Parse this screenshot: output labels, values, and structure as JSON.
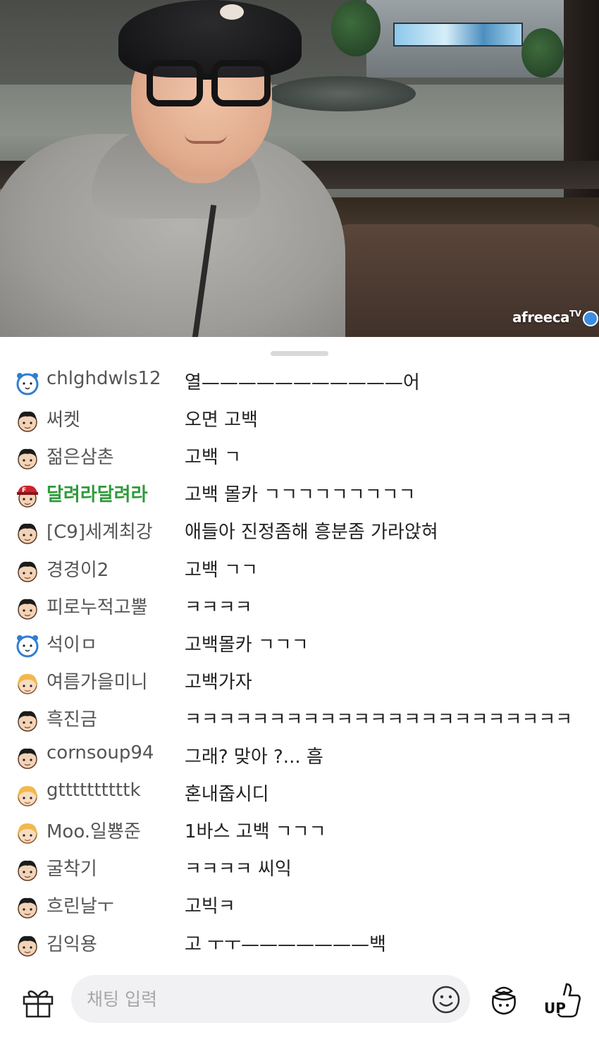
{
  "video": {
    "watermark": "afreeca",
    "watermark_suffix": "TV"
  },
  "chat": {
    "messages": [
      {
        "avatar": "mascot-icon",
        "nickname": "chlghdwls12",
        "text": "열———————————어"
      },
      {
        "avatar": "user-face-icon",
        "nickname": "써켓",
        "text": "오면 고백"
      },
      {
        "avatar": "user-face-icon",
        "nickname": "젊은삼촌",
        "text": "고백 ㄱ"
      },
      {
        "avatar": "fan-badge-icon",
        "nickname": "달려라달려라",
        "text": "고백 몰카 ㄱㄱㄱㄱㄱㄱㄱㄱㄱ",
        "highlight": true
      },
      {
        "avatar": "user-face-icon",
        "nickname": "[C9]세계최강",
        "text": "애들아 진정좀해 흥분좀 가라앉혀"
      },
      {
        "avatar": "user-face-icon",
        "nickname": "경경이2",
        "text": "고백 ㄱㄱ"
      },
      {
        "avatar": "user-face-icon",
        "nickname": "피로누적고뿔",
        "text": "ㅋㅋㅋㅋ"
      },
      {
        "avatar": "mascot-icon",
        "nickname": "석이ㅁ",
        "text": "고백몰카 ㄱㄱㄱ"
      },
      {
        "avatar": "girl-face-icon",
        "nickname": "여름가을미니",
        "text": "고백가자"
      },
      {
        "avatar": "user-face-icon",
        "nickname": "흑진금",
        "text": "ㅋㅋㅋㅋㅋㅋㅋㅋㅋㅋㅋㅋㅋㅋㅋㅋㅋㅋㅋㅋㅋㅋㅋ"
      },
      {
        "avatar": "user-face-icon",
        "nickname": "cornsoup94",
        "text": "그래? 맞아 ?... 흠"
      },
      {
        "avatar": "girl-face-icon",
        "nickname": "gttttttttttk",
        "text": "혼내줍시디"
      },
      {
        "avatar": "girl-face-icon",
        "nickname": "Moo.일뿅준",
        "text": "1바스 고백 ㄱㄱㄱ"
      },
      {
        "avatar": "user-face-icon",
        "nickname": "굴착기",
        "text": "ㅋㅋㅋㅋ 씨익"
      },
      {
        "avatar": "user-face-icon",
        "nickname": "흐린날ㅜ",
        "text": "고빅ㅋ"
      },
      {
        "avatar": "user-face-icon",
        "nickname": "김익용",
        "text": "고 ㅜㅜ———————백"
      }
    ]
  },
  "input": {
    "placeholder": "채팅 입력"
  },
  "toolbar": {
    "up_label": "UP"
  },
  "colors": {
    "nickname": "#555555",
    "highlight_nickname": "#2f9a3a",
    "input_bg": "#f1f1f3"
  }
}
